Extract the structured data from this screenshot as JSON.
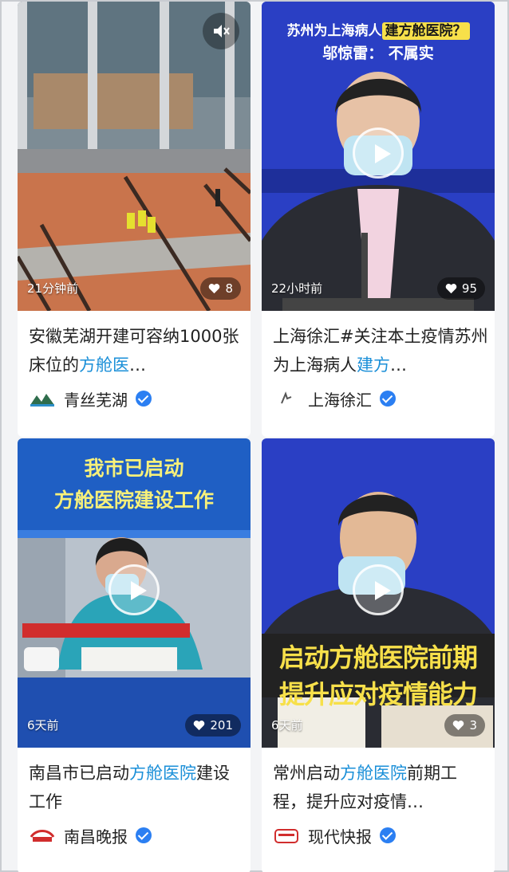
{
  "feed": {
    "cards": [
      {
        "time": "21分钟前",
        "likes": "8",
        "title_plain": "安徽芜湖开建可容纳1000张床位的",
        "title_highlight": "方舱医",
        "title_tail": "…",
        "author": "青丝芜湖",
        "verified": true
      },
      {
        "time": "22小时前",
        "likes": "95",
        "overlay_top": "苏州为上海病人",
        "overlay_top_highlight": "建方舱医院？",
        "overlay_sub": "邬惊雷： 不属实",
        "title_plain": "上海徐汇#关注本土疫情苏州为上海病人",
        "title_highlight": "建方",
        "title_tail": "…",
        "author": "上海徐汇",
        "verified": true
      },
      {
        "time": "6天前",
        "likes": "201",
        "overlay_line1": "我市已启动",
        "overlay_line2": "方舱医院建设工作",
        "title_plain": "南昌市已启动",
        "title_highlight": "方舱医院",
        "title_tail": "建设工作",
        "author": "南昌晚报",
        "verified": true
      },
      {
        "time": "6天前",
        "likes": "3",
        "overlay_line1": "启动方舱医院前期",
        "overlay_line2": "提升应对疫情能力",
        "title_plain": "常州启动",
        "title_highlight": "方舱医院",
        "title_tail": "前期工程，提升应对疫情…",
        "author": "现代快报",
        "verified": true
      }
    ]
  },
  "colors": {
    "highlight": "#1a8fd8",
    "verified": "#2b7ff2",
    "banner_blue": "#2440c8",
    "banner_yellow": "#f7e04a"
  }
}
